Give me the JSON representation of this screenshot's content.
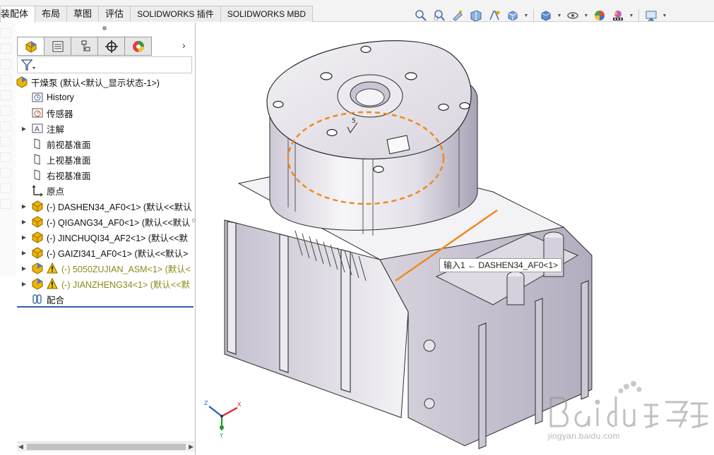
{
  "tabs": [
    {
      "label": "装配体",
      "active": true
    },
    {
      "label": "布局"
    },
    {
      "label": "草图"
    },
    {
      "label": "评估"
    },
    {
      "label": "SOLIDWORKS 插件"
    },
    {
      "label": "SOLIDWORKS MBD"
    }
  ],
  "tree": {
    "root": "干燥泵 (默认<默认_显示状态-1>)",
    "history": "History",
    "sensors": "传感器",
    "annotations": "注解",
    "front_plane": "前视基准面",
    "top_plane": "上视基准面",
    "right_plane": "右视基准面",
    "origin": "原点",
    "components": [
      {
        "label": "(-) DASHEN34_AF0<1> (默认<<默认",
        "warn": false
      },
      {
        "label": "(-) QIGANG34_AF0<1> (默认<<默认",
        "warn": false
      },
      {
        "label": "(-) JINCHUQI34_AF2<1> (默认<<默",
        "warn": false
      },
      {
        "label": "(-) GAIZI341_AF0<1> (默认<<默认>",
        "warn": false
      },
      {
        "label": "(-) 5050ZUJIAN_ASM<1> (默认<",
        "warn": true
      },
      {
        "label": "(-) JIANZHENG34<1> (默认<<默",
        "warn": true
      }
    ],
    "mates": "配合"
  },
  "graphics": {
    "tooltip": "输入1 ← DASHEN34_AF0<1>",
    "watermark_sub": "jingyan.baidu.com",
    "triad": {
      "x": "X",
      "y": "Y",
      "z": "Z"
    }
  },
  "colors": {
    "accent": "#2f62a8",
    "annotation": "#f08a1c",
    "warning": "#8d8a1d"
  }
}
